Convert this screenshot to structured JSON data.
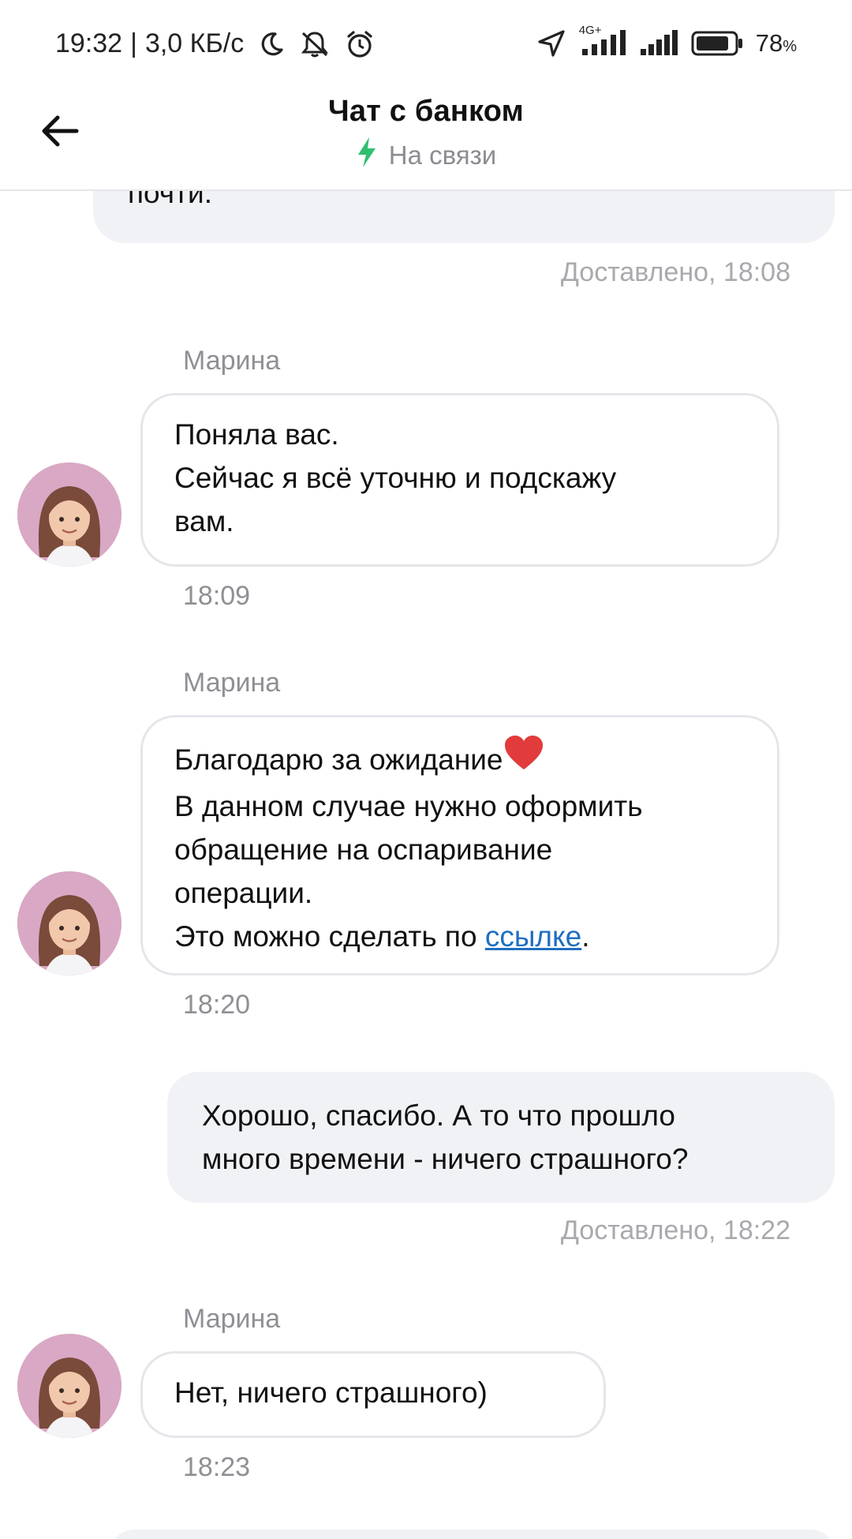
{
  "status_bar": {
    "time": "19:32",
    "separator": "|",
    "speed": "3,0 КБ/с",
    "network": "4G+",
    "battery": "78",
    "battery_unit": "%",
    "icons": [
      "moon-icon",
      "muted-bell-icon",
      "alarm-icon",
      "location-arrow-icon",
      "signal-icon",
      "signal-icon",
      "battery-icon"
    ]
  },
  "header": {
    "title": "Чат с банком",
    "status": "На связи",
    "status_color": "#2fbf71"
  },
  "messages": {
    "m0": {
      "text": "почти.",
      "meta": "Доставлено, 18:08"
    },
    "m1": {
      "sender": "Марина",
      "lines": [
        "Поняла вас.",
        "Сейчас я всё уточню и подскажу",
        "вам."
      ],
      "time": "18:09"
    },
    "m2": {
      "sender": "Марина",
      "line1": "Благодарю за ожидание",
      "lines": [
        "В данном случае нужно оформить",
        "обращение на оспаривание",
        "операции."
      ],
      "last_prefix": "Это можно сделать по ",
      "link": "ссылке",
      "last_suffix": ".",
      "time": "18:20"
    },
    "m3": {
      "lines": [
        "Хорошо, спасибо. А то что прошло",
        "много времени - ничего страшного?"
      ],
      "meta": "Доставлено, 18:22"
    },
    "m4": {
      "sender": "Марина",
      "text": "Нет, ничего страшного)",
      "time": "18:23"
    }
  },
  "colors": {
    "link": "#1f6fc1",
    "user_bubble": "#f1f2f5",
    "agent_border": "#e5e6ea"
  }
}
